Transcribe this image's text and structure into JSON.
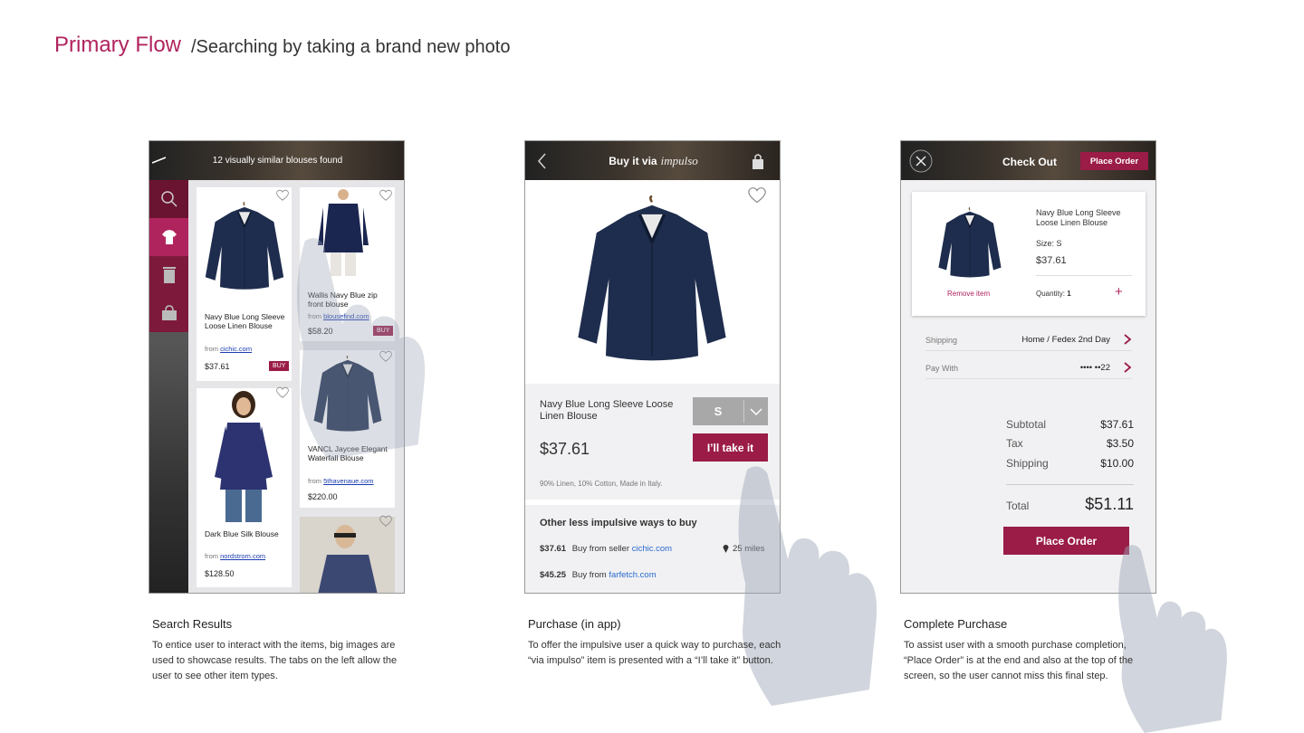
{
  "header": {
    "title": "Primary Flow",
    "subtitle": "/Searching by taking a brand new photo"
  },
  "colors": {
    "accent": "#9a1c47",
    "title": "#b0245e",
    "link": "#1a3bb0"
  },
  "screen1": {
    "topbar_title": "12 visually similar blouses found",
    "sidebar": [
      {
        "icon": "search-icon"
      },
      {
        "icon": "blouse-icon",
        "active": true
      },
      {
        "icon": "trash-icon"
      },
      {
        "icon": "bag-icon"
      }
    ],
    "cards": [
      {
        "name": "Navy Blue Long Sleeve Loose Linen Blouse",
        "from": "from",
        "store": "cichic.com",
        "price": "$37.61",
        "buy": "BUY"
      },
      {
        "name": "Wallis Navy Blue zip front blouse",
        "from": "from",
        "store": "blousefind.com",
        "price": "$58.20",
        "buy": "BUY"
      },
      {
        "name": "VANCL Jaycee Elegant Waterfall Blouse",
        "from": "from",
        "store": "5thavenaue.com",
        "price": "$220.00"
      },
      {
        "name": "Dark Blue Silk Blouse",
        "from": "from",
        "store": "nordstrom.com",
        "price": "$128.50"
      }
    ],
    "caption_title": "Search Results",
    "caption_text": "To entice user to interact with the items, big images are used to showcase results. The tabs on the left allow the user to see other item types."
  },
  "screen2": {
    "topbar_title": "Buy it via",
    "topbar_brand": "impulso",
    "product_name": "Navy Blue Long Sleeve Loose Linen Blouse",
    "price": "$37.61",
    "size": "S",
    "take_button": "I’ll take it",
    "material": "90% Linen, 10% Cotton, Made in Italy.",
    "other_title": "Other less impulsive ways to buy",
    "other": [
      {
        "price": "$37.61",
        "text": "Buy from seller",
        "store": "cichic.com",
        "distance": "25 miles"
      },
      {
        "price": "$45.25",
        "text": "Buy from",
        "store": "farfetch.com"
      }
    ],
    "caption_title": "Purchase (in app)",
    "caption_text": "To offer the impulsive user a quick way to purchase, each “via impulso” item is presented with a “I’ll take it” button."
  },
  "screen3": {
    "topbar_title": "Check Out",
    "place_order_top": "Place Order",
    "item_name": "Navy Blue Long Sleeve Loose Linen Blouse",
    "size": "Size: S",
    "price": "$37.61",
    "remove": "Remove item",
    "quantity_label": "Quantity:",
    "quantity": "1",
    "shipping_label": "Shipping",
    "shipping_value": "Home / Fedex 2nd Day",
    "pay_label": "Pay With",
    "pay_value": "•••• ••22",
    "subtotal_label": "Subtotal",
    "subtotal": "$37.61",
    "tax_label": "Tax",
    "tax": "$3.50",
    "ship_label": "Shipping",
    "ship_cost": "$10.00",
    "total_label": "Total",
    "total": "$51.11",
    "place_order": "Place Order",
    "caption_title": "Complete Purchase",
    "caption_text": "To assist user with a smooth purchase completion, “Place Order” is at the end and also at the top of the screen, so the user cannot miss this final step."
  }
}
